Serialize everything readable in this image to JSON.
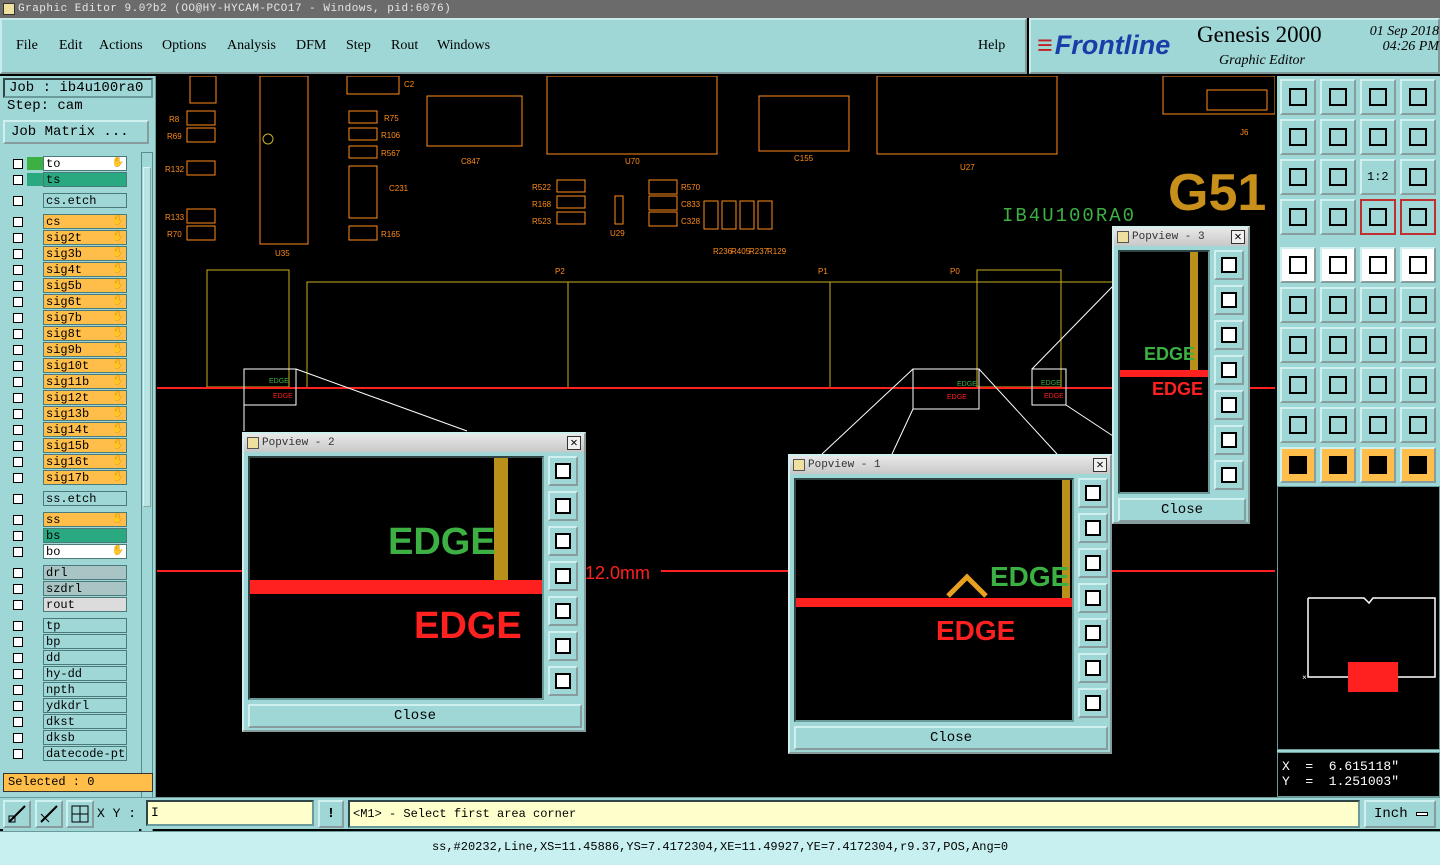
{
  "window": {
    "title": "Graphic Editor 9.0?b2 (OO@HY-HYCAM-PCO17 - Windows, pid:6076)"
  },
  "menu": {
    "items": [
      "File",
      "Edit",
      "Actions",
      "Options",
      "Analysis",
      "DFM",
      "Step",
      "Rout",
      "Windows"
    ],
    "help": "Help"
  },
  "brand": {
    "logo": "Frontline",
    "product": "Genesis 2000",
    "subtitle": "Graphic Editor",
    "date": "01 Sep 2018",
    "time": "04:26 PM"
  },
  "left": {
    "job": "Job : ib4u100ra0",
    "step": "Step: cam",
    "job_matrix": "Job Matrix ...",
    "layers": [
      {
        "name": "to",
        "color": "#ffffff",
        "swatch": "#3cb043",
        "hand": true
      },
      {
        "name": "ts",
        "color": "#2aa880",
        "swatch": "#2aa880",
        "hand": false
      },
      {
        "name": "cs.etch",
        "color": "#9fd6d6",
        "swatch": "",
        "hand": false,
        "sep": true
      },
      {
        "name": "cs",
        "color": "#ffbe4a",
        "swatch": "",
        "hand": true,
        "sep": true
      },
      {
        "name": "sig2t",
        "color": "#ffbe4a",
        "swatch": "",
        "hand": true
      },
      {
        "name": "sig3b",
        "color": "#ffbe4a",
        "swatch": "",
        "hand": true
      },
      {
        "name": "sig4t",
        "color": "#ffbe4a",
        "swatch": "",
        "hand": true
      },
      {
        "name": "sig5b",
        "color": "#ffbe4a",
        "swatch": "",
        "hand": true
      },
      {
        "name": "sig6t",
        "color": "#ffbe4a",
        "swatch": "",
        "hand": true
      },
      {
        "name": "sig7b",
        "color": "#ffbe4a",
        "swatch": "",
        "hand": true
      },
      {
        "name": "sig8t",
        "color": "#ffbe4a",
        "swatch": "",
        "hand": true
      },
      {
        "name": "sig9b",
        "color": "#ffbe4a",
        "swatch": "",
        "hand": true
      },
      {
        "name": "sig10t",
        "color": "#ffbe4a",
        "swatch": "",
        "hand": true
      },
      {
        "name": "sig11b",
        "color": "#ffbe4a",
        "swatch": "",
        "hand": true
      },
      {
        "name": "sig12t",
        "color": "#ffbe4a",
        "swatch": "",
        "hand": true
      },
      {
        "name": "sig13b",
        "color": "#ffbe4a",
        "swatch": "",
        "hand": true
      },
      {
        "name": "sig14t",
        "color": "#ffbe4a",
        "swatch": "",
        "hand": true
      },
      {
        "name": "sig15b",
        "color": "#ffbe4a",
        "swatch": "",
        "hand": true
      },
      {
        "name": "sig16t",
        "color": "#ffbe4a",
        "swatch": "",
        "hand": true
      },
      {
        "name": "sig17b",
        "color": "#ffbe4a",
        "swatch": "",
        "hand": true
      },
      {
        "name": "ss.etch",
        "color": "#9fd6d6",
        "swatch": "",
        "hand": false,
        "sep": true
      },
      {
        "name": "ss",
        "color": "#ffbe4a",
        "swatch": "",
        "hand": true,
        "sep": true
      },
      {
        "name": "bs",
        "color": "#2aa880",
        "swatch": "",
        "hand": false
      },
      {
        "name": "bo",
        "color": "#ffffff",
        "swatch": "",
        "hand": true
      },
      {
        "name": "drl",
        "color": "#a8c4c4",
        "swatch": "",
        "hand": false,
        "sep": true
      },
      {
        "name": "szdrl",
        "color": "#a8c4c4",
        "swatch": "",
        "hand": false
      },
      {
        "name": "rout",
        "color": "#dcdcdc",
        "swatch": "",
        "hand": false
      },
      {
        "name": "tp",
        "color": "#9fd6d6",
        "swatch": "",
        "hand": false,
        "sep": true
      },
      {
        "name": "bp",
        "color": "#9fd6d6",
        "swatch": "",
        "hand": false
      },
      {
        "name": "dd",
        "color": "#9fd6d6",
        "swatch": "",
        "hand": false
      },
      {
        "name": "hy-dd",
        "color": "#9fd6d6",
        "swatch": "",
        "hand": false
      },
      {
        "name": "npth",
        "color": "#9fd6d6",
        "swatch": "",
        "hand": false
      },
      {
        "name": "ydkdrl",
        "color": "#9fd6d6",
        "swatch": "",
        "hand": false
      },
      {
        "name": "dkst",
        "color": "#9fd6d6",
        "swatch": "",
        "hand": false
      },
      {
        "name": "dksb",
        "color": "#9fd6d6",
        "swatch": "",
        "hand": false
      },
      {
        "name": "datecode-pte",
        "color": "#9fd6d6",
        "swatch": "",
        "hand": false
      }
    ],
    "selected": "Selected : 0"
  },
  "canvas": {
    "labels": [
      "R8",
      "R69",
      "R132",
      "R133",
      "R70",
      "U35",
      "C2",
      "R75",
      "R106",
      "R567",
      "R165",
      "C231",
      "C847",
      "U70",
      "R522",
      "R168",
      "R523",
      "U29",
      "R570",
      "C833",
      "C328",
      "R236",
      "R405",
      "R237",
      "R129",
      "C155",
      "U27",
      "J6",
      "P2",
      "P1",
      "P0"
    ],
    "big_text": "G51",
    "board_id": "IB4U100RA0",
    "measure": "12.0mm",
    "edge_label": "EDGE",
    "colors": {
      "red": "#ff2020",
      "orange": "#ff8c1a",
      "yellow": "#c8b020",
      "green": "#3cb043",
      "gold": "#b8901a"
    }
  },
  "popviews": [
    {
      "id": "2",
      "title": "Popview - 2",
      "close": "Close",
      "edge_top": "EDGE",
      "edge_bottom": "EDGE"
    },
    {
      "id": "1",
      "title": "Popview - 1",
      "close": "Close",
      "edge_top": "EDGE",
      "edge_bottom": "EDGE"
    },
    {
      "id": "3",
      "title": "Popview - 3",
      "close": "Close",
      "edge_top": "EDGE",
      "edge_bottom": "EDGE"
    }
  ],
  "coords": {
    "x": "X  =  6.615118\"",
    "y": "Y  =  1.251003\""
  },
  "cmdbar": {
    "xy_label": "X Y :",
    "xy_value": "",
    "excl": "!",
    "prompt": "<M1> - Select first area corner",
    "units": "Inch"
  },
  "status": {
    "text": "ss,#20232,Line,XS=11.45886,YS=7.4172304,XE=11.49927,YE=7.4172304,r9.37,POS,Ang=0"
  },
  "tools": {
    "scale": "1:2"
  }
}
